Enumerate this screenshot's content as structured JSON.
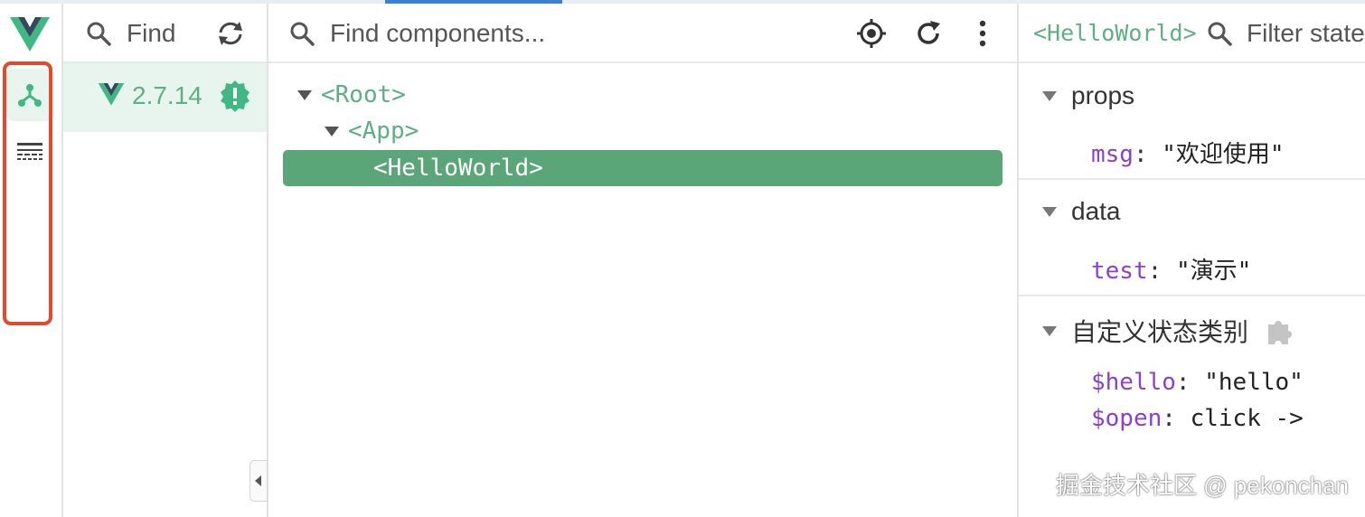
{
  "colors": {
    "vue_green": "#5fae84",
    "selection": "#5aa679",
    "highlight": "#e24a2f",
    "key_purple": "#8a3fd1"
  },
  "rail": {
    "items": [
      {
        "icon": "component-tree-icon",
        "active": true
      },
      {
        "icon": "timeline-icon",
        "active": false
      }
    ]
  },
  "apps": {
    "find_label": "Find",
    "app_version": "2.7.14"
  },
  "tree": {
    "search_placeholder": "Find components...",
    "nodes": [
      {
        "label": "<Root>",
        "expanded": true
      },
      {
        "label": "<App>",
        "expanded": true
      },
      {
        "label": "<HelloWorld>",
        "selected": true
      }
    ]
  },
  "inspector": {
    "component_title": "<HelloWorld>",
    "filter_placeholder": "Filter state",
    "sections": [
      {
        "title": "props",
        "fields": [
          {
            "key": "msg",
            "value": "\"欢迎使用\""
          }
        ]
      },
      {
        "title": "data",
        "fields": [
          {
            "key": "test",
            "value": "\"演示\""
          }
        ]
      },
      {
        "title": "自定义状态类别",
        "fields": [
          {
            "key": "$hello",
            "value": "\"hello\""
          },
          {
            "key": "$open",
            "value": "click ->"
          }
        ]
      }
    ]
  },
  "watermark": "掘金技术社区 @ pekonchan"
}
